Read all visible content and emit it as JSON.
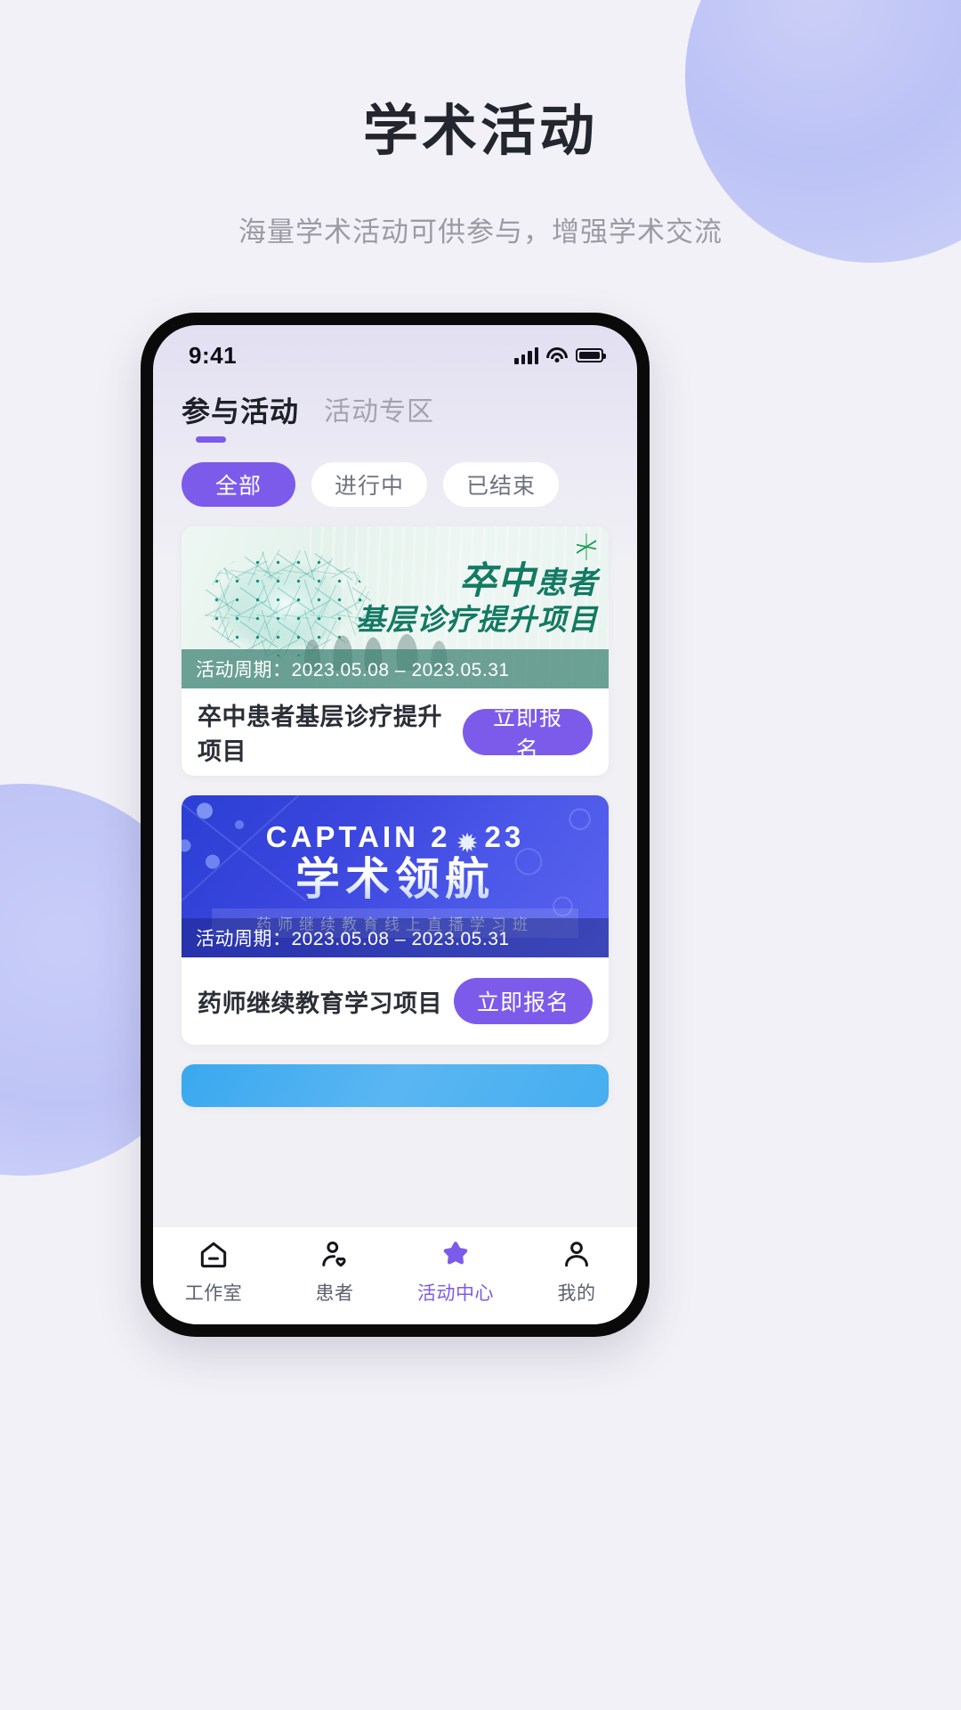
{
  "hero": {
    "title": "学术活动",
    "subtitle": "海量学术活动可供参与，增强学术交流"
  },
  "colors": {
    "accent": "#7c5bea",
    "page_bg": "#f2f1f7",
    "blob": "#c2c8f7",
    "banner1": "#3a8070",
    "banner2": "#3b46de",
    "banner3": "#4aaef0"
  },
  "status_bar": {
    "time": "9:41",
    "signal_icon": "cellular-signal-icon",
    "wifi_icon": "wifi-icon",
    "battery_icon": "battery-full-icon"
  },
  "top_tabs": [
    {
      "label": "参与活动",
      "active": true
    },
    {
      "label": "活动专区",
      "active": false
    }
  ],
  "filter_chips": [
    {
      "label": "全部",
      "active": true
    },
    {
      "label": "进行中",
      "active": false
    },
    {
      "label": "已结束",
      "active": false
    }
  ],
  "cards": [
    {
      "banner_text_line1": "卒中",
      "banner_text_line1b": "患者",
      "banner_text_line2": "基层诊疗提升项目",
      "period": "活动周期：2023.05.08 – 2023.05.31",
      "title": "卒中患者基层诊疗提升项目",
      "button": "立即报名"
    },
    {
      "banner_text_line1": "CAPTAIN 2",
      "banner_text_line1c": "23",
      "banner_text_line2": "学术领航",
      "banner_text_line3": "药师继续教育线上直播学习班",
      "period": "活动周期：2023.05.08 – 2023.05.31",
      "title": "药师继续教育学习项目",
      "button": "立即报名"
    }
  ],
  "bottom_nav": [
    {
      "label": "工作室",
      "icon": "home-icon",
      "active": false
    },
    {
      "label": "患者",
      "icon": "patient-heart-icon",
      "active": false
    },
    {
      "label": "活动中心",
      "icon": "star-icon",
      "active": true
    },
    {
      "label": "我的",
      "icon": "person-icon",
      "active": false
    }
  ]
}
